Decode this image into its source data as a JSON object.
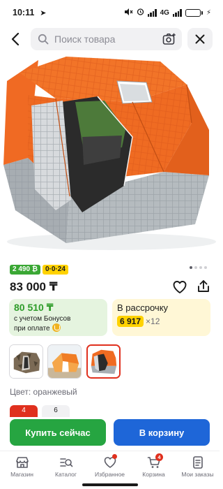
{
  "status_bar": {
    "time": "10:11",
    "network": "4G",
    "battery": "93"
  },
  "search": {
    "placeholder": "Поиск товара"
  },
  "product": {
    "badge_bonus": "2 490",
    "badge_installment": "0·0·24",
    "price": "83 000 ₸",
    "image_count": 4,
    "active_image_index": 1
  },
  "bonus_card": {
    "amount": "80 510 ₸",
    "note_line1": "с учетом Бонусов",
    "note_line2": "при оплате"
  },
  "installment_card": {
    "title": "В рассрочку",
    "monthly": "6 917",
    "months": "×12"
  },
  "thumbnails": [
    {
      "name": "thumb-camo"
    },
    {
      "name": "thumb-orange-outdoor"
    },
    {
      "name": "thumb-orange-grey"
    }
  ],
  "color": {
    "label": "Цвет: оранжевый"
  },
  "sizes": [
    "4",
    "6"
  ],
  "actions": {
    "buy_label": "Купить сейчас",
    "cart_label": "В корзину"
  },
  "nav": {
    "items": [
      {
        "label": "Магазин",
        "icon": "shop-icon"
      },
      {
        "label": "Каталог",
        "icon": "catalog-icon"
      },
      {
        "label": "Избранное",
        "icon": "heart-icon"
      },
      {
        "label": "Корзина",
        "icon": "cart-icon"
      },
      {
        "label": "Мои заказы",
        "icon": "orders-icon"
      }
    ],
    "cart_count": "4"
  },
  "colors": {
    "accent_red": "#e0301e",
    "buy_green": "#26a541",
    "cart_blue": "#1e66d8",
    "bonus_yellow": "#ffd200"
  }
}
